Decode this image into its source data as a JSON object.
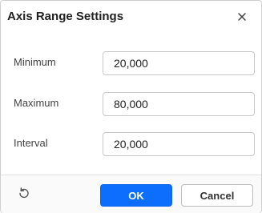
{
  "dialog": {
    "title": "Axis Range Settings",
    "close_icon": "close-icon"
  },
  "fields": [
    {
      "label": "Minimum",
      "value": "20,000"
    },
    {
      "label": "Maximum",
      "value": "80,000"
    },
    {
      "label": "Interval",
      "value": "20,000"
    }
  ],
  "footer": {
    "reset_icon": "reset-icon",
    "ok_label": "OK",
    "cancel_label": "Cancel"
  },
  "colors": {
    "primary": "#0d6efd",
    "border": "#c8c8c8"
  }
}
